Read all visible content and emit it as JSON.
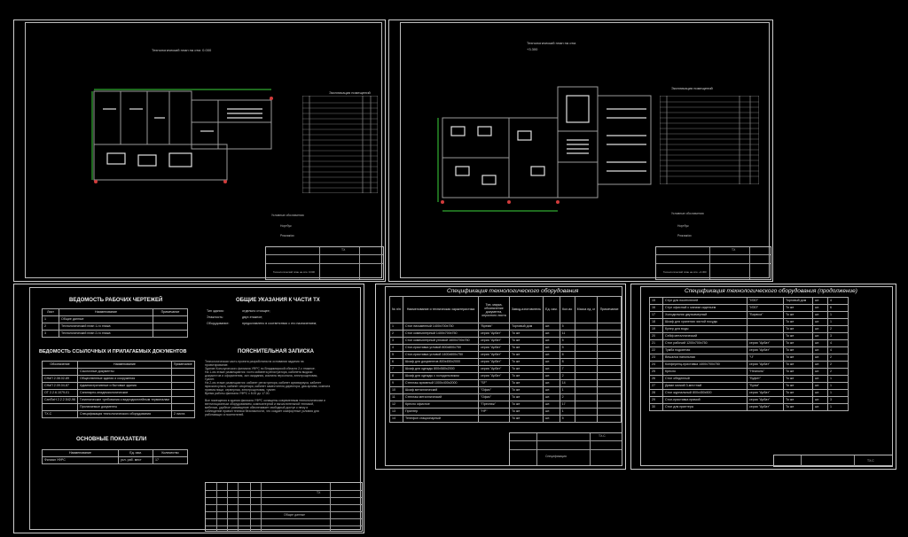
{
  "sheet1": {
    "plan_title": "Технологический план на отм. 0.000",
    "legend_title": "Экспликация помещений",
    "legend_heading": "Условные обозначения",
    "legend_items": [
      "Ноутбук",
      "Рюкзак/ки"
    ],
    "stamp_title": "Технологический план на отм. 0.000",
    "stamp_code": "ТХ"
  },
  "sheet2": {
    "plan_title": "Технологический план на отм.",
    "plan_level": "+3.300",
    "legend_title": "Экспликация помещений",
    "legend_heading": "Условные обозначения",
    "legend_items": [
      "Ноутбук",
      "Рюкзак/ки"
    ],
    "stamp_title": "Технологический план на отм. +3.300",
    "stamp_code": "ТХ"
  },
  "sheet3": {
    "title_drawings": "ВЕДОМОСТЬ РАБОЧИХ ЧЕРТЕЖЕЙ",
    "drawings_headers": [
      "Лист",
      "Наименование",
      "Примечание"
    ],
    "drawings_rows": [
      [
        "1",
        "Общие данные",
        ""
      ],
      [
        "2",
        "Технологический план 1-го этажа",
        ""
      ],
      [
        "3",
        "Технологический план 2-го этажа",
        ""
      ]
    ],
    "title_general": "ОБЩИЕ УКАЗАНИЯ К ЧАСТИ ТХ",
    "general_rows": [
      [
        "Тип здания:",
        "отдельно стоящее;"
      ],
      [
        "Этажность:",
        "двух этажное;"
      ],
      [
        "Оборудование:",
        "предоставлено в соответствии с его назначением;"
      ]
    ],
    "title_refs": "ВЕДОМОСТЬ ССЫЛОЧНЫХ И ПРИЛАГАЕМЫХ ДОКУМЕНТОВ",
    "refs_headers": [
      "Обозначение",
      "Наименование",
      "Примечание"
    ],
    "refs_rows": [
      [
        "",
        "Ссылочные документы",
        ""
      ],
      [
        "СНиП 2.08.02-89",
        "Общественные здания и сооружения",
        ""
      ],
      [
        "СНиП 2.09.04-87",
        "Административные и бытовые здания",
        ""
      ],
      [
        "ОТ 2.2.6.1079-01",
        "Санитарно-эпидемиологические",
        ""
      ],
      [
        "СанПиН 2.2.2.542-96",
        "Гигиенические требования к видеодисплейным терминалам",
        ""
      ],
      [
        "",
        "Прилагаемые документы",
        ""
      ],
      [
        "ТХ.С",
        "Спецификация технологического оборудования",
        "2 листа"
      ]
    ],
    "title_notes": "ПОЯСНИТЕЛЬНАЯ ЗАПИСКА",
    "notes_text": [
      "Технологическая часть проекта разработана на основании задания на",
      "проектирование.",
      "Здание Кольчугинского филиала УФРС по Владимирской области 2-х этажное.",
      "На 1-ом этаже размещаются: гостя кабинета регистратора, кабинета выдачи",
      "документов и оформления, зал ожидания, комната персонала, электрощитовая,",
      "туалет.",
      "На 2-ом этаже размещаются: кабинет регистратора, кабинет архивариуса, кабинет",
      "юрисконсульта, кабинет секретаря, кабинет заместителя директора, два архива, комната",
      "приема пищи, серверная, электрощитовая, туалет.",
      "Время работы филиала УФРС с 8.00 до 17.00.",
      "",
      "Все помещения в здании филиала УФРС оснащены современным технологическим и",
      "вентиляционным оборудованием, компьютерной и вычислительной техникой,",
      "мебелью, удобное размещение обеспечивает свободный доступ к нему и",
      "соблюдение правил техники безопасности, что создает комфортные условия для",
      "работающих и посетителей."
    ],
    "title_indicators": "ОСНОВНЫЕ ПОКАЗАТЕЛИ",
    "indicators_headers": [
      "Наименование",
      "Ед. изм.",
      "Количество"
    ],
    "indicators_rows": [
      [
        "Филиал УФРС",
        "усл. раб. мест",
        "17"
      ]
    ],
    "stamp_title": "Общие данные",
    "stamp_code": "ТХ"
  },
  "sheet4": {
    "title": "Спецификация технологического оборудования",
    "headers": [
      "№ п/п",
      "Наименование и техническая характеристика",
      "Тип, марка, обозначение документа, опросного листа",
      "Завод-изготовитель",
      "Ед. изм.",
      "Кол-во",
      "Масса ед. кг",
      "Примечание"
    ],
    "rows": [
      [
        "1",
        "Стол письменный 1400х700х750",
        "\"Время\"",
        "Торговый дом",
        "шт.",
        "5"
      ],
      [
        "2",
        "Стол компьютерный 1400х700х750",
        "серия \"Арбат\"",
        "То же",
        "шт.",
        "11"
      ],
      [
        "3",
        "Стол компьютерный угловой 1600х700х750",
        "серия \"Арбат\"",
        "То же",
        "шт.",
        "5"
      ],
      [
        "4",
        "Стол-приставка угловой 800х800х750",
        "серия \"Арбат\"",
        "То же",
        "шт.",
        "5"
      ],
      [
        "5",
        "Стол-приставка угловой 1400х600х750",
        "серия \"Арбат\"",
        "То же",
        "шт.",
        "6"
      ],
      [
        "6",
        "Шкаф для документов 800х450х2000",
        "серия \"Арбат\"",
        "То же",
        "шт.",
        "8"
      ],
      [
        "7",
        "Шкаф для одежды 800х580х2000",
        "серия \"Арбат\"",
        "То же",
        "шт.",
        "7"
      ],
      [
        "8",
        "Шкаф для одежды с холодильником",
        "серия \"Арбат\"",
        "То же",
        "шт.",
        "2"
      ],
      [
        "9",
        "Стеллаж архивный 1000х400х2000",
        "\"SF\"",
        "То же",
        "шт.",
        "14"
      ],
      [
        "10",
        "Шкаф металлический",
        "\"Офис\"",
        "То же",
        "шт.",
        "1"
      ],
      [
        "11",
        "Стеллаж металлический",
        "\"Офис\"",
        "То же",
        "шт.",
        "2"
      ],
      [
        "12",
        "Кресло офисное",
        "\"Престиж\"",
        "То же",
        "шт.",
        "17"
      ],
      [
        "13",
        "Принтер",
        "\"HP\"",
        "То же",
        "шт.",
        "1"
      ],
      [
        "14",
        "Телефон стационарный",
        "",
        "То же",
        "шт.",
        "5"
      ]
    ],
    "stamp_title": "Спецификация",
    "stamp_code": "ТХ.С"
  },
  "sheet5": {
    "title": "Спецификация технологического оборудования (продолжение)",
    "rows": [
      [
        "15",
        "Стул для посетителей",
        "\"ИЗО\"",
        "Торговый дом",
        "шт.",
        "4"
      ],
      [
        "16",
        "Стул офисный с мягким сиденьем",
        "\"ИЗО\"",
        "То же",
        "шт.",
        "6"
      ],
      [
        "17",
        "Холодильник двухкамерный",
        "\"Бирюса\"",
        "То же",
        "шт.",
        "1"
      ],
      [
        "18",
        "Шкаф для хранения чистой посуды",
        "",
        "То же",
        "шт.",
        "1"
      ],
      [
        "19",
        "Кулер для воды",
        "",
        "То же",
        "шт.",
        "2"
      ],
      [
        "20",
        "Сейф металлический",
        "",
        "То же",
        "шт.",
        "3"
      ],
      [
        "21",
        "Стол рабочий 1200х700х750",
        "серия \"Арбат\"",
        "То же",
        "шт.",
        "4"
      ],
      [
        "22",
        "Тумба подкатная",
        "серия \"Арбат\"",
        "То же",
        "шт.",
        "4"
      ],
      [
        "23",
        "Вешалка напольная",
        "\"Ч\"",
        "То же",
        "шт.",
        "2"
      ],
      [
        "24",
        "Конференц-приставка 1400х700х750",
        "серия \"Арбат\"",
        "То же",
        "шт.",
        "2"
      ],
      [
        "25",
        "Кресло",
        "\"Неаполь\"",
        "То же",
        "шт.",
        "2"
      ],
      [
        "26",
        "Стол обеденный",
        "\"Буфет\"",
        "То же",
        "шт.",
        "1"
      ],
      [
        "27",
        "Диван мягкий 3-местный",
        "\"Брэм\"",
        "То же",
        "шт.",
        "1"
      ],
      [
        "28",
        "Стол журнальный 800х450х500",
        "серия \"Арбат\"",
        "То же",
        "шт.",
        "1"
      ],
      [
        "29",
        "Стол-приставка прямой",
        "серия \"Арбат\"",
        "То же",
        "шт.",
        "3"
      ],
      [
        "30",
        "Стол для принтера",
        "серия \"Арбат\"",
        "То же",
        "шт.",
        "1"
      ]
    ],
    "stamp_code": "ТХ.С"
  }
}
